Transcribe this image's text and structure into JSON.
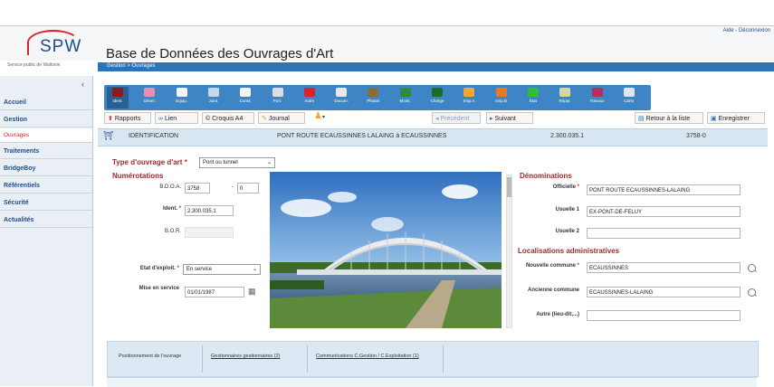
{
  "header": {
    "logo_text": "SPW",
    "logo_subtitle": "Service public de Wallonie",
    "app_title": "Base de Données des Ouvrages d'Art",
    "top_links": "Aide - Déconnexion",
    "breadcrumb": "Gestion > Ouvrages"
  },
  "sidebar": {
    "collapse_icon": "chevron-left-icon",
    "items": [
      {
        "label": "Accueil"
      },
      {
        "label": "Gestion"
      },
      {
        "label": "Ouvrages"
      },
      {
        "label": "Traitements"
      },
      {
        "label": "BridgeBoy"
      },
      {
        "label": "Référentiels"
      },
      {
        "label": "Sécurité"
      },
      {
        "label": "Actualités"
      }
    ]
  },
  "toolbar": {
    "tools": [
      {
        "label": "Ident.",
        "icon": "bridge-icon",
        "color": "#8b1a1a"
      },
      {
        "label": "Géom.",
        "icon": "geometry-icon",
        "color": "#e58fb5"
      },
      {
        "label": "Equip.",
        "icon": "gear-icon",
        "color": "#f5f5f5"
      },
      {
        "label": "Joint.",
        "icon": "joint-icon",
        "color": "#c9d6e6"
      },
      {
        "label": "Const.",
        "icon": "construction-icon",
        "color": "#f5f5f5"
      },
      {
        "label": "Port.",
        "icon": "span-icon",
        "color": "#dddddd"
      },
      {
        "label": "Autre",
        "icon": "flag-icon",
        "color": "#d8232a"
      },
      {
        "label": "Docum.",
        "icon": "document-icon",
        "color": "#e9e9e9"
      },
      {
        "label": "Photos",
        "icon": "photo-icon",
        "color": "#8a6b3d"
      },
      {
        "label": "Monit.",
        "icon": "monitor-icon",
        "color": "#2e8b3e"
      },
      {
        "label": "Charge",
        "icon": "truck-icon",
        "color": "#1f6b2a"
      },
      {
        "label": "Insp.A",
        "icon": "inspection-a-icon",
        "color": "#f0a830"
      },
      {
        "label": "Insp.B",
        "icon": "inspection-b-icon",
        "color": "#e57a2e"
      },
      {
        "label": "Etat",
        "icon": "health-cross-icon",
        "color": "#2fbf3a"
      },
      {
        "label": "Répar.",
        "icon": "repair-icon",
        "color": "#d6d6a0"
      },
      {
        "label": "Travaux",
        "icon": "works-icon",
        "color": "#b03060"
      },
      {
        "label": "Carto",
        "icon": "map-icon",
        "color": "#e0e6ee"
      }
    ]
  },
  "actions": {
    "rapports": "Rapports",
    "lien": "Lien",
    "croquis": "Croquis A4",
    "journal": "Journal",
    "precedent": "Précédent",
    "suivant": "Suivant",
    "retour": "Retour à la liste",
    "enregistrer": "Enregistrer"
  },
  "identification_bar": {
    "section": "IDENTIFICATION",
    "name": "PONT ROUTE ECAUSSINNES LALAING à ECAUSSINNES",
    "code": "2.300.035.1",
    "number": "3758-0"
  },
  "form": {
    "type_label": "Type d'ouvrage d'art",
    "type_value": "Pont ou tunnel",
    "numerotations_title": "Numérotations",
    "bdoa_label": "B.D.O.A.",
    "bdoa_value": "3758",
    "bdoa_sep": "-",
    "bdoa_suffix": "0",
    "ident_label": "Ident.",
    "ident_value": "2.300.035.1",
    "bor_label": "B.O.R.",
    "bor_value": "",
    "etat_label": "Etat d'exploit.",
    "etat_value": "En service",
    "mise_label": "Mise en service",
    "mise_value": "01/01/1987",
    "denominations_title": "Dénominations",
    "officielle_label": "Officielle",
    "officielle_value": "PONT ROUTE ECAUSSINNES-LALAING",
    "usuelle1_label": "Usuelle 1",
    "usuelle1_value": "EX-PONT-DE-FELUY",
    "usuelle2_label": "Usuelle 2",
    "usuelle2_value": "",
    "localisations_title": "Localisations administratives",
    "nouvelle_label": "Nouvelle commune",
    "nouvelle_value": "ECAUSSINNES",
    "ancienne_label": "Ancienne commune",
    "ancienne_value": "ECAUSSINNES-LALAING",
    "autre_label": "Autre (lieu-dit,...)",
    "autre_value": "",
    "required_mark": "*"
  },
  "tabs": [
    {
      "label": "Positionnement de l'ouvrage"
    },
    {
      "label": "Gestionnaires gestionnaires (2)"
    },
    {
      "label": "Communications C.Gestion / C.Exploitation (1)"
    }
  ],
  "colors": {
    "toolbar": "#3e85c6",
    "breadcrumb": "#2d73b5",
    "brand_red": "#d8232a",
    "brand_blue": "#1f4e8c",
    "section_red": "#9b2a2a"
  }
}
